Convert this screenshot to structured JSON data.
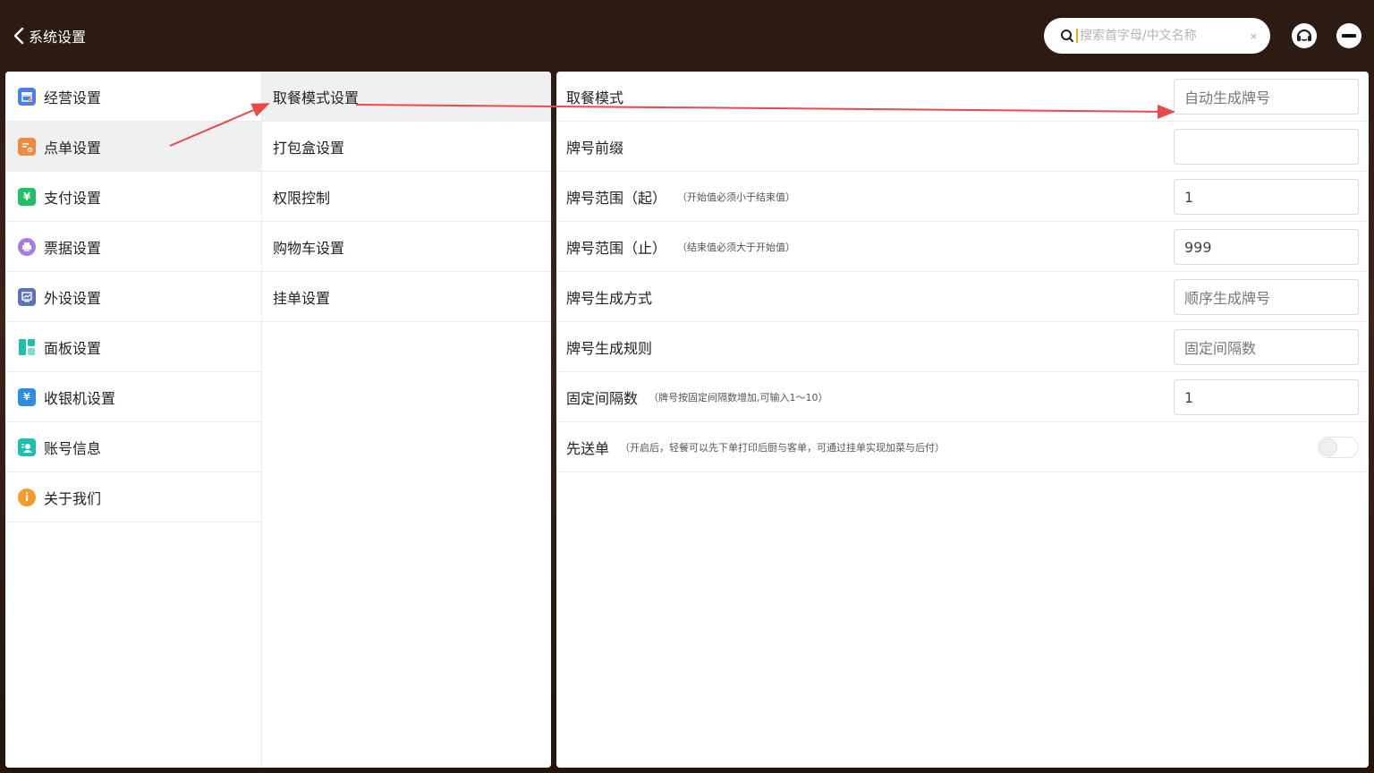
{
  "header": {
    "back_label": "系统设置",
    "search_placeholder": "搜索首字母/中文名称",
    "clear_symbol": "×"
  },
  "nav": {
    "items": [
      {
        "label": "经营设置",
        "icon": "store-settings-icon",
        "color": "#4a7fe8"
      },
      {
        "label": "点单设置",
        "icon": "order-settings-icon",
        "color": "#f08a3c"
      },
      {
        "label": "支付设置",
        "icon": "payment-yen-icon",
        "color": "#22c065"
      },
      {
        "label": "票据设置",
        "icon": "printer-icon",
        "color": "#a77ee0"
      },
      {
        "label": "外设设置",
        "icon": "monitor-icon",
        "color": "#5a73b8"
      },
      {
        "label": "面板设置",
        "icon": "panel-layout-icon",
        "color": "#1fbfb0"
      },
      {
        "label": "收银机设置",
        "icon": "cashier-icon",
        "color": "#2e8de0"
      },
      {
        "label": "账号信息",
        "icon": "account-icon",
        "color": "#1fbfb0"
      },
      {
        "label": "关于我们",
        "icon": "info-icon",
        "color": "#f39a2a"
      }
    ]
  },
  "subnav": {
    "items": [
      {
        "label": "取餐模式设置"
      },
      {
        "label": "打包盒设置"
      },
      {
        "label": "权限控制"
      },
      {
        "label": "购物车设置"
      },
      {
        "label": "挂单设置"
      }
    ]
  },
  "settings": {
    "rows": [
      {
        "label": "取餐模式",
        "hint": "",
        "value": "自动生成牌号"
      },
      {
        "label": "牌号前缀",
        "hint": "",
        "value": ""
      },
      {
        "label": "牌号范围（起）",
        "hint": "（开始值必须小于结束值）",
        "value": "1"
      },
      {
        "label": "牌号范围（止）",
        "hint": "（结束值必须大于开始值）",
        "value": "999"
      },
      {
        "label": "牌号生成方式",
        "hint": "",
        "value": "顺序生成牌号"
      },
      {
        "label": "牌号生成规则",
        "hint": "",
        "value": "固定间隔数"
      },
      {
        "label": "固定间隔数",
        "hint": "（牌号按固定间隔数增加,可输入1～10）",
        "value": "1"
      },
      {
        "label": "先送单",
        "hint": "（开启后，轻餐可以先下单打印后厨与客单，可通过挂单实现加菜与后付）",
        "toggle_on": false
      }
    ]
  },
  "colors": {
    "annotation_arrow": "#e84a4a",
    "active_bg": "#f0f0f0"
  }
}
